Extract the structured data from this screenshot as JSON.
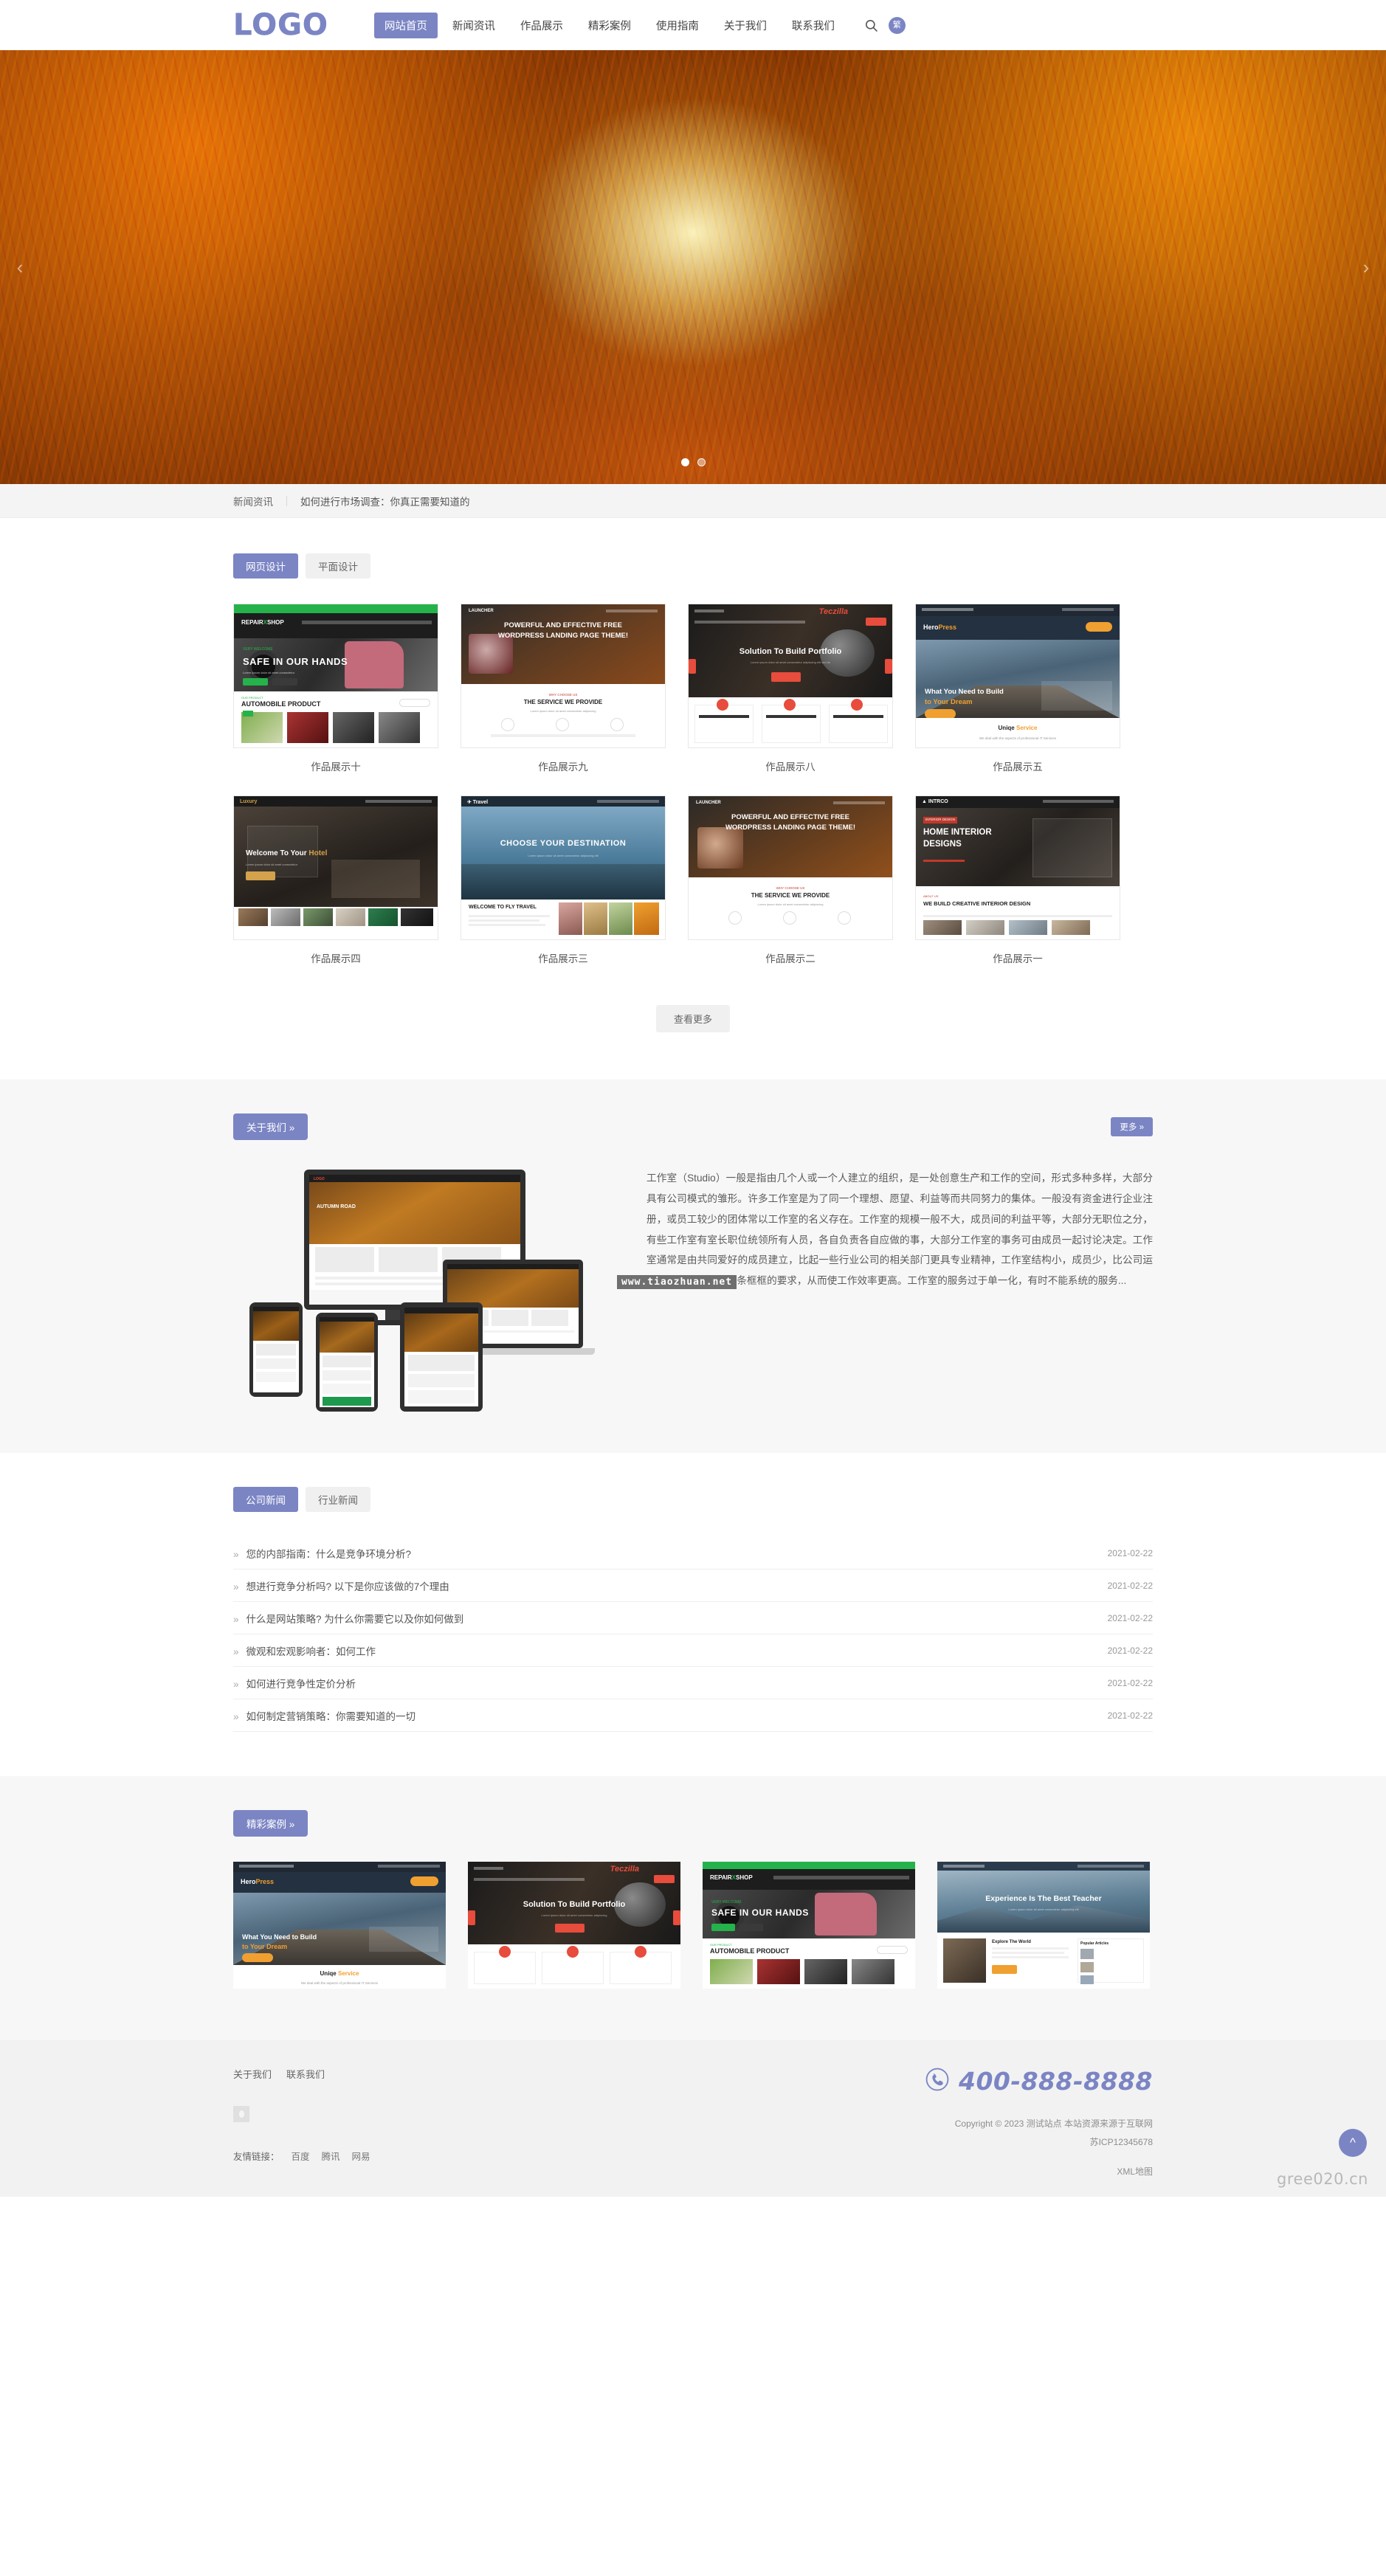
{
  "header": {
    "logo": "LOGO",
    "nav": [
      {
        "label": "网站首页",
        "active": true
      },
      {
        "label": "新闻资讯",
        "active": false
      },
      {
        "label": "作品展示",
        "active": false
      },
      {
        "label": "精彩案例",
        "active": false
      },
      {
        "label": "使用指南",
        "active": false
      },
      {
        "label": "关于我们",
        "active": false
      },
      {
        "label": "联系我们",
        "active": false
      }
    ],
    "search_icon": "search-icon",
    "lang_badge": "繁"
  },
  "hero": {
    "prev_arrow": "‹",
    "next_arrow": "›",
    "dots": 2,
    "active_dot": 0
  },
  "ticker": {
    "tag": "新闻资讯",
    "headline": "如何进行市场调查：你真正需要知道的"
  },
  "portfolio": {
    "tabs": [
      {
        "label": "网页设计",
        "active": true
      },
      {
        "label": "平面设计",
        "active": false
      }
    ],
    "items": [
      {
        "caption": "作品展示十",
        "mock": "autoshop"
      },
      {
        "caption": "作品展示九",
        "mock": "launcher"
      },
      {
        "caption": "作品展示八",
        "mock": "teczilla"
      },
      {
        "caption": "作品展示五",
        "mock": "heropress"
      },
      {
        "caption": "作品展示四",
        "mock": "interior2"
      },
      {
        "caption": "作品展示三",
        "mock": "travel"
      },
      {
        "caption": "作品展示二",
        "mock": "launcher2"
      },
      {
        "caption": "作品展示一",
        "mock": "intrco"
      }
    ],
    "more_button": "查看更多"
  },
  "about": {
    "title_button": "关于我们 »",
    "more_button": "更多 »",
    "watermark": "www.tiaozhuan.net",
    "text": "工作室（Studio）一般是指由几个人或一个人建立的组织，是一处创意生产和工作的空间，形式多种多样，大部分具有公司模式的雏形。许多工作室是为了同一个理想、愿望、利益等而共同努力的集体。一般没有资金进行企业注册，或员工较少的团体常以工作室的名义存在。工作室的规模一般不大，成员间的利益平等，大部分无职位之分，有些工作室有室长职位统领所有人员，各自负责各自应做的事，大部分工作室的事务可由成员一起讨论决定。工作室通常是由共同爱好的成员建立，比起一些行业公司的相关部门更具专业精神，工作室结构小，成员少，比公司运作灵活，没有过多条条框框的要求，从而使工作效率更高。工作室的服务过于单一化，有时不能系统的服务..."
  },
  "news": {
    "tabs": [
      {
        "label": "公司新闻",
        "active": true
      },
      {
        "label": "行业新闻",
        "active": false
      }
    ],
    "items": [
      {
        "title": "您的内部指南：什么是竞争环境分析?",
        "date": "2021-02-22"
      },
      {
        "title": "想进行竞争分析吗? 以下是你应该做的7个理由",
        "date": "2021-02-22"
      },
      {
        "title": "什么是网站策略? 为什么你需要它以及你如何做到",
        "date": "2021-02-22"
      },
      {
        "title": "微观和宏观影响者：如何工作",
        "date": "2021-02-22"
      },
      {
        "title": "如何进行竞争性定价分析",
        "date": "2021-02-22"
      },
      {
        "title": "如何制定营销策略：你需要知道的一切",
        "date": "2021-02-22"
      }
    ]
  },
  "cases": {
    "title_button": "精彩案例 »",
    "items": [
      {
        "mock": "heropress"
      },
      {
        "mock": "teczilla"
      },
      {
        "mock": "autoshop"
      },
      {
        "mock": "education"
      }
    ]
  },
  "footer": {
    "links": [
      "关于我们",
      "联系我们"
    ],
    "friend_label": "友情链接：",
    "friend_links": [
      "百度",
      "腾讯",
      "网易"
    ],
    "phone": "400-888-8888",
    "phone_icon": "phone-icon",
    "copyright": "Copyright © 2023 测试站点 本站资源来源于互联网",
    "icp": "苏ICP12345678",
    "xml": "XML地图",
    "to_top_icon": "chevron-up-icon",
    "site_watermark": "gree020.cn",
    "qr_icon": "qr-code-icon"
  },
  "colors": {
    "accent": "#7b85c4",
    "page_bg": "#ffffff",
    "section_bg": "#f7f7f7",
    "footer_bg": "#f2f2f2"
  }
}
